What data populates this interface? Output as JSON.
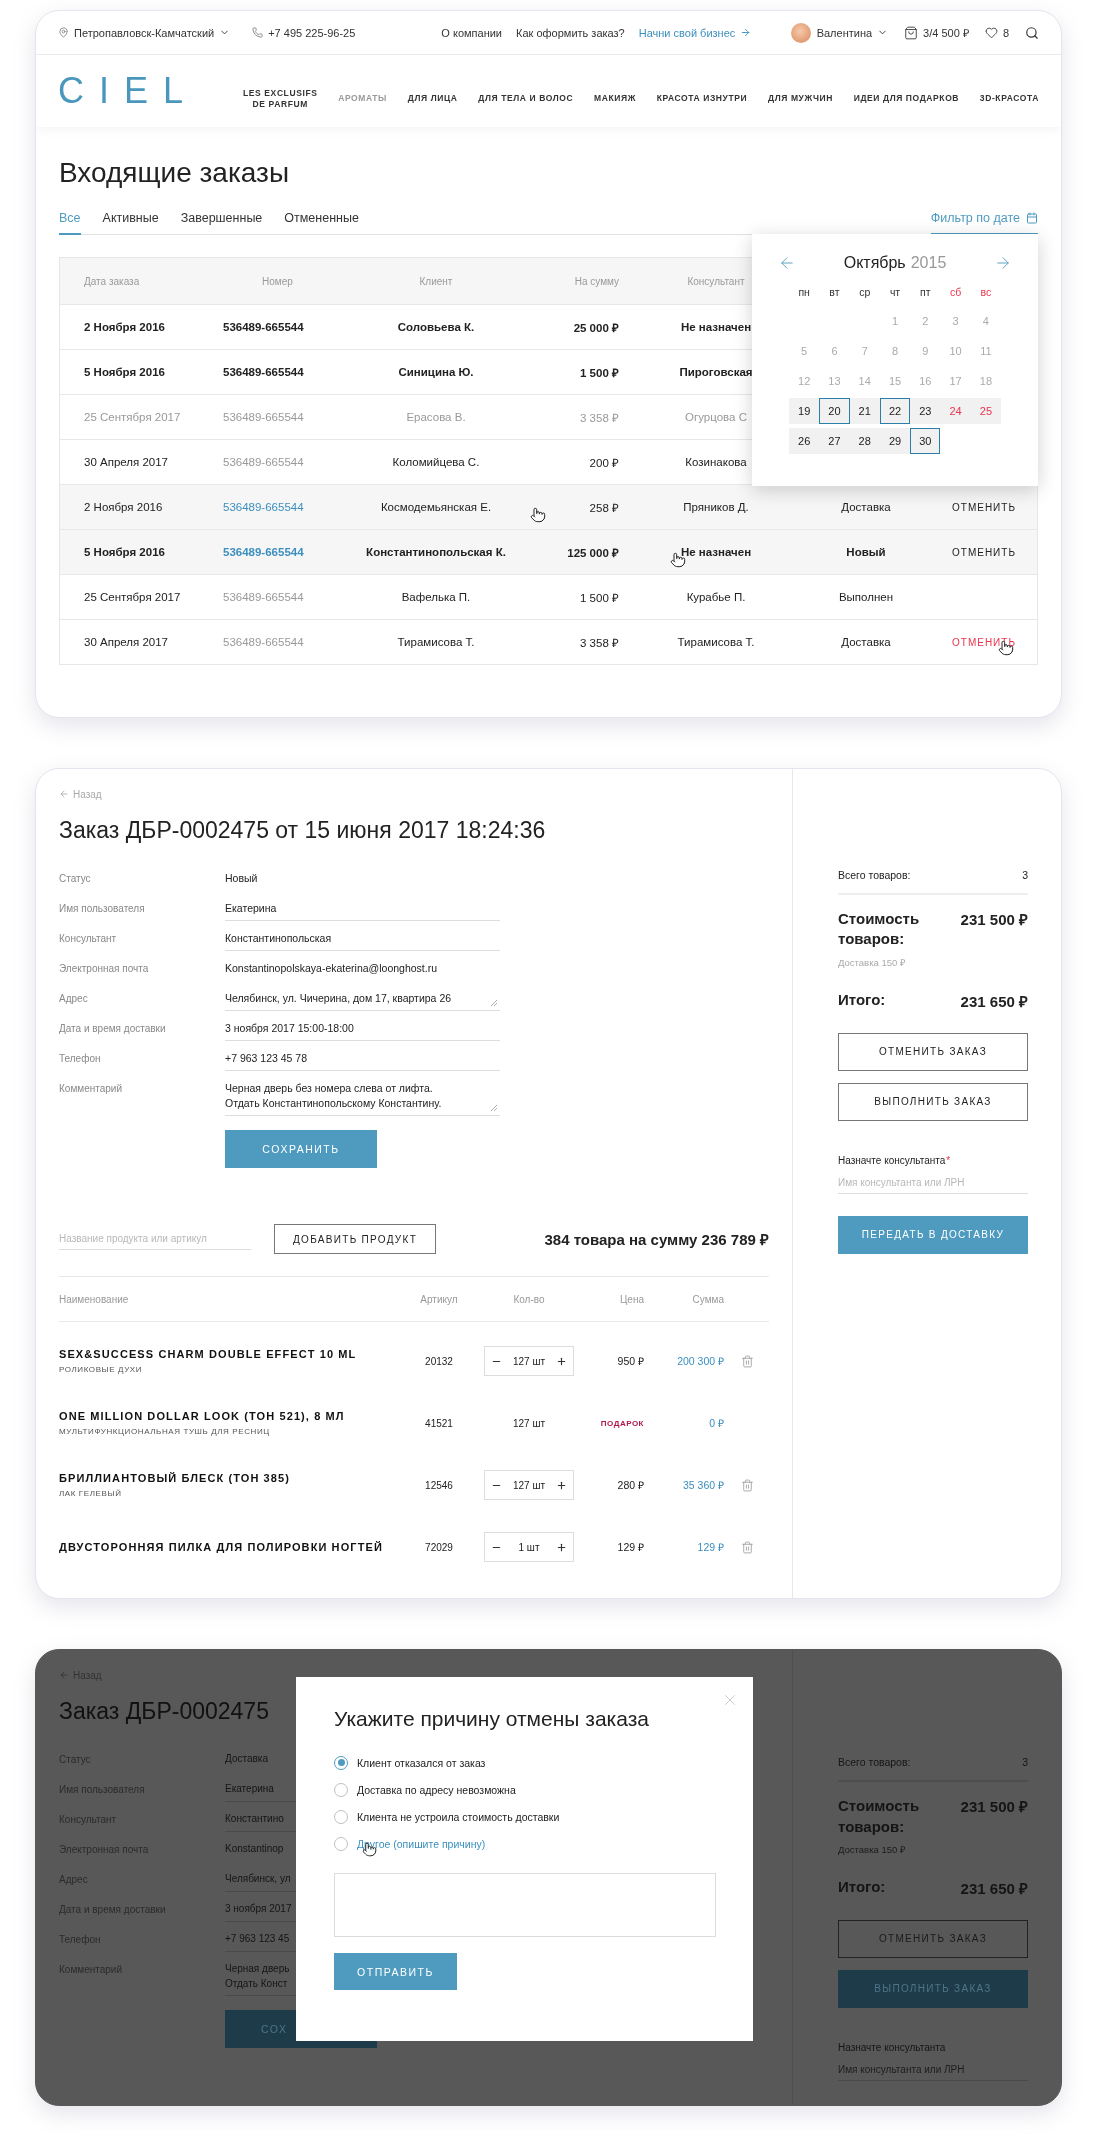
{
  "header": {
    "city": "Петропавловск-Камчатский",
    "phone": "+7 495 225-96-25",
    "links": [
      {
        "label": "О компании",
        "accent": false
      },
      {
        "label": "Как оформить заказ?",
        "accent": false
      },
      {
        "label": "Начни свой бизнес",
        "accent": true
      }
    ],
    "user": "Валентина",
    "cart": "3/4 500 ₽",
    "favorites": "8"
  },
  "logo": "CIEL",
  "nav": [
    {
      "label": "LES EXCLUSIFS\nDE PARFUM",
      "selected": false
    },
    {
      "label": "АРОМАТЫ",
      "selected": true
    },
    {
      "label": "ДЛЯ ЛИЦА",
      "selected": false
    },
    {
      "label": "ДЛЯ ТЕЛА И ВОЛОС",
      "selected": false
    },
    {
      "label": "МАКИЯЖ",
      "selected": false
    },
    {
      "label": "КРАСОТА ИЗНУТРИ",
      "selected": false
    },
    {
      "label": "ДЛЯ МУЖЧИН",
      "selected": false
    },
    {
      "label": "ИДЕИ ДЛЯ ПОДАРКОВ",
      "selected": false
    },
    {
      "label": "3D-КРАСОТА",
      "selected": false
    }
  ],
  "orders": {
    "title": "Входящие заказы",
    "tabs": [
      {
        "label": "Все",
        "selected": true
      },
      {
        "label": "Активные",
        "selected": false
      },
      {
        "label": "Завершенные",
        "selected": false
      },
      {
        "label": "Отмененные",
        "selected": false
      }
    ],
    "date_filter": {
      "label": "Фильтр по дате",
      "open": true
    },
    "columns": [
      "Дата заказа",
      "Номер",
      "Клиент",
      "На сумму",
      "Консультант"
    ],
    "rows": [
      {
        "date": "2 Ноября 2016",
        "number": "536489-665544",
        "client": "Соловьева К.",
        "sum": "25 000 ₽",
        "consultant": "Не назначен",
        "bold": true,
        "muted": false,
        "hovered": false,
        "action_hovered": false
      },
      {
        "date": "5 Ноября 2016",
        "number": "536489-665544",
        "client": "Синицина Ю.",
        "sum": "1 500 ₽",
        "consultant": "Пироговская",
        "bold": true,
        "muted": false,
        "hovered": false,
        "action_hovered": false
      },
      {
        "date": "25 Сентября 2017",
        "number": "536489-665544",
        "client": "Ерасова В.",
        "sum": "3 358 ₽",
        "consultant": "Огурцова С",
        "bold": false,
        "muted": true,
        "hovered": false,
        "action_hovered": false
      },
      {
        "date": "30 Апреля 2017",
        "number": "536489-665544",
        "client": "Коломийцева С.",
        "sum": "200 ₽",
        "consultant": "Козинакова",
        "bold": false,
        "muted": false,
        "hovered": false,
        "action_hovered": false
      },
      {
        "date": "2 Ноября 2016",
        "number": "536489-665544",
        "client": "Космодемьянская Е.",
        "sum": "258 ₽",
        "consultant": "Пряников Д.",
        "status": "Доставка",
        "action": "ОТМЕНИТЬ",
        "bold": false,
        "muted": false,
        "hovered": true,
        "action_hovered": false
      },
      {
        "date": "5 Ноября 2016",
        "number": "536489-665544",
        "client": "Константинопольская К.",
        "sum": "125 000 ₽",
        "consultant": "Не назначен",
        "status": "Новый",
        "action": "ОТМЕНИТЬ",
        "bold": true,
        "muted": false,
        "hovered": true,
        "action_hovered": false
      },
      {
        "date": "25 Сентября 2017",
        "number": "536489-665544",
        "client": "Вафелька П.",
        "sum": "1 500 ₽",
        "consultant": "Курабье П.",
        "status": "Выполнен",
        "bold": false,
        "muted": false,
        "hovered": false,
        "action_hovered": false
      },
      {
        "date": "30 Апреля 2017",
        "number": "536489-665544",
        "client": "Тирамисова Т.",
        "sum": "3 358 ₽",
        "consultant": "Тирамисова Т.",
        "status": "Доставка",
        "action": "ОТМЕНИТЬ",
        "bold": false,
        "muted": false,
        "hovered": false,
        "action_hovered": true
      }
    ],
    "calendar": {
      "month": "Октябрь",
      "year": "2015",
      "weekdays": [
        {
          "label": "пн",
          "weekend": false
        },
        {
          "label": "вт",
          "weekend": false
        },
        {
          "label": "ср",
          "weekend": false
        },
        {
          "label": "чт",
          "weekend": false
        },
        {
          "label": "пт",
          "weekend": false
        },
        {
          "label": "сб",
          "weekend": true
        },
        {
          "label": "вс",
          "weekend": true
        }
      ],
      "weeks": [
        {
          "muted": true,
          "highlighted": false,
          "days": [
            {
              "day": "1",
              "selected": false
            },
            {
              "day": "2",
              "selected": false
            },
            {
              "day": "3",
              "selected": false
            },
            {
              "day": "4",
              "selected": false
            }
          ]
        },
        {
          "muted": true,
          "highlighted": false,
          "days": [
            {
              "day": "5",
              "selected": false
            },
            {
              "day": "6",
              "selected": false
            },
            {
              "day": "7",
              "selected": false
            },
            {
              "day": "8",
              "selected": false
            },
            {
              "day": "9",
              "selected": false
            },
            {
              "day": "10",
              "selected": false
            },
            {
              "day": "11",
              "selected": false
            }
          ]
        },
        {
          "muted": true,
          "highlighted": false,
          "days": [
            {
              "day": "12",
              "selected": false
            },
            {
              "day": "13",
              "selected": false
            },
            {
              "day": "14",
              "selected": false
            },
            {
              "day": "15",
              "selected": false
            },
            {
              "day": "16",
              "selected": false
            },
            {
              "day": "17",
              "selected": false
            },
            {
              "day": "18",
              "selected": false
            }
          ]
        },
        {
          "muted": false,
          "highlighted": true,
          "days": [
            {
              "day": "19",
              "selected": false
            },
            {
              "day": "20",
              "selected": true
            },
            {
              "day": "21",
              "selected": false
            },
            {
              "day": "22",
              "selected": true
            },
            {
              "day": "23",
              "selected": false
            },
            {
              "day": "24",
              "selected": false
            },
            {
              "day": "25",
              "selected": false
            }
          ]
        },
        {
          "muted": false,
          "highlighted": true,
          "days": [
            {
              "day": "26",
              "selected": false
            },
            {
              "day": "27",
              "selected": false
            },
            {
              "day": "28",
              "selected": false
            },
            {
              "day": "29",
              "selected": false
            },
            {
              "day": "30",
              "selected": true
            }
          ]
        }
      ]
    }
  },
  "order": {
    "back": "Назад",
    "title": "Заказ ДБР-0002475 от 15 июня 2017 18:24:36",
    "fields": [
      {
        "label": "Статус",
        "value": "Новый",
        "kind": "text"
      },
      {
        "label": "Имя пользователя",
        "value": "Екатерина",
        "kind": "input"
      },
      {
        "label": "Консультант",
        "value": "Константинопольская",
        "kind": "input"
      },
      {
        "label": "Электронная почта",
        "value": "Konstantinopolskaya-ekaterina@loonghost.ru",
        "kind": "text"
      },
      {
        "label": "Адрес",
        "value": "Челябинск, ул. Чичерина, дом 17, квартира 26",
        "kind": "textarea"
      },
      {
        "label": "Дата и время доставки",
        "value": "3 ноября 2017 15:00-18:00",
        "kind": "input"
      },
      {
        "label": "Телефон",
        "value": "+7 963 123 45 78",
        "kind": "input"
      },
      {
        "label": "Комментарий",
        "value": "Черная дверь без номера слева от лифта.\nОтдать Константинопольскому Константину.",
        "kind": "textarea"
      }
    ],
    "save": "СОХРАНИТЬ",
    "products": {
      "search_placeholder": "Название продукта или артикул",
      "add": "ДОБАВИТЬ ПРОДУКТ",
      "total": "384 товара на сумму 236 789 ₽",
      "columns": [
        "Наименование",
        "Артикул",
        "Кол-во",
        "Цена",
        "Сумма"
      ],
      "items": [
        {
          "kind": "item",
          "name": "SEX&SUCCESS CHARM DOUBLE EFFECT 10 ML",
          "subtitle": "РОЛИКОВЫЕ ДУХИ",
          "article": "20132",
          "qty": "127 шт",
          "price": "950 ₽",
          "sum": "200 300 ₽"
        },
        {
          "kind": "gift",
          "name": "ONE MILLION DOLLAR LOOK (ТОН 521), 8 МЛ",
          "subtitle": "МУЛЬТИФУНКЦИОНАЛЬНАЯ ТУШЬ ДЛЯ РЕСНИЦ",
          "article": "41521",
          "qty": "127 шт",
          "price": "ПОДАРОК",
          "sum": "0 ₽"
        },
        {
          "kind": "item",
          "name": "БРИЛЛИАНТОВЫЙ БЛЕСК (ТОН 385)",
          "subtitle": "ЛАК ГЕЛЕВЫЙ",
          "article": "12546",
          "qty": "127 шт",
          "price": "280 ₽",
          "sum": "35 360 ₽"
        },
        {
          "kind": "item",
          "name": "ДВУСТОРОННЯЯ ПИЛКА ДЛЯ ПОЛИРОВКИ НОГТЕЙ",
          "article": "72029",
          "qty": "1 шт",
          "price": "129 ₽",
          "sum": "129 ₽"
        }
      ]
    },
    "summary": {
      "count_label": "Всего товаров:",
      "count": "3",
      "cost_label": "Стоимость товаров:",
      "cost": "231 500 ₽",
      "delivery": "Доставка 150 ₽",
      "total_label": "Итого:",
      "total": "231 650 ₽",
      "buttons": [
        {
          "label": "ОТМЕНИТЬ ЗАКАЗ",
          "kind": "outline"
        },
        {
          "label": "ВЫПОЛНИТЬ ЗАКАЗ",
          "kind": "outline"
        }
      ],
      "consultant_label": "Назначте консультанта",
      "required_mark": "*",
      "consultant_placeholder": "Имя консультанта или ЛРН",
      "deliver": "ПЕРЕДАТЬ В ДОСТАВКУ"
    }
  },
  "cancel_view": {
    "dimmed": true,
    "back": "Назад",
    "title": "Заказ ДБР-0002475",
    "fields": [
      {
        "label": "Статус",
        "value": "Доставка",
        "kind": "text"
      },
      {
        "label": "Имя пользователя",
        "value": "Екатерина",
        "kind": "input"
      },
      {
        "label": "Консультант",
        "value": "Константино",
        "kind": "input"
      },
      {
        "label": "Электронная почта",
        "value": "Konstantinop",
        "kind": "text"
      },
      {
        "label": "Адрес",
        "value": "Челябинск, ул",
        "kind": "textarea"
      },
      {
        "label": "Дата и время доставки",
        "value": "3 ноября 2017",
        "kind": "input"
      },
      {
        "label": "Телефон",
        "value": "+7 963 123 45",
        "kind": "input"
      },
      {
        "label": "Комментарий",
        "value": "Черная дверь\nОтдать Конст",
        "kind": "textarea"
      }
    ],
    "save": "СОХ",
    "summary": {
      "count_label": "Всего товаров:",
      "count": "3",
      "cost_label": "Стоимость товаров:",
      "cost": "231 500 ₽",
      "delivery": "Доставка 150 ₽",
      "total_label": "Итого:",
      "total": "231 650 ₽",
      "buttons": [
        {
          "label": "ОТМЕНИТЬ ЗАКАЗ",
          "kind": "outline"
        },
        {
          "label": "ВЫПОЛНИТЬ ЗАКАЗ",
          "kind": "primary"
        }
      ],
      "consultant_label": "Назначте консультанта",
      "consultant_placeholder": "Имя консультанта или ЛРН"
    },
    "modal": {
      "title": "Укажите причину отмены заказа",
      "options": [
        {
          "label": "Клиент отказался от заказ",
          "selected": true,
          "hovered": false
        },
        {
          "label": "Доставка по адресу невозможна",
          "selected": false,
          "hovered": false
        },
        {
          "label": "Клиента не устроила стоимость доставки",
          "selected": false,
          "hovered": false
        },
        {
          "label": "Другое (опишите причину)",
          "selected": false,
          "hovered": true
        }
      ],
      "submit": "ОТПРАВИТЬ"
    }
  }
}
